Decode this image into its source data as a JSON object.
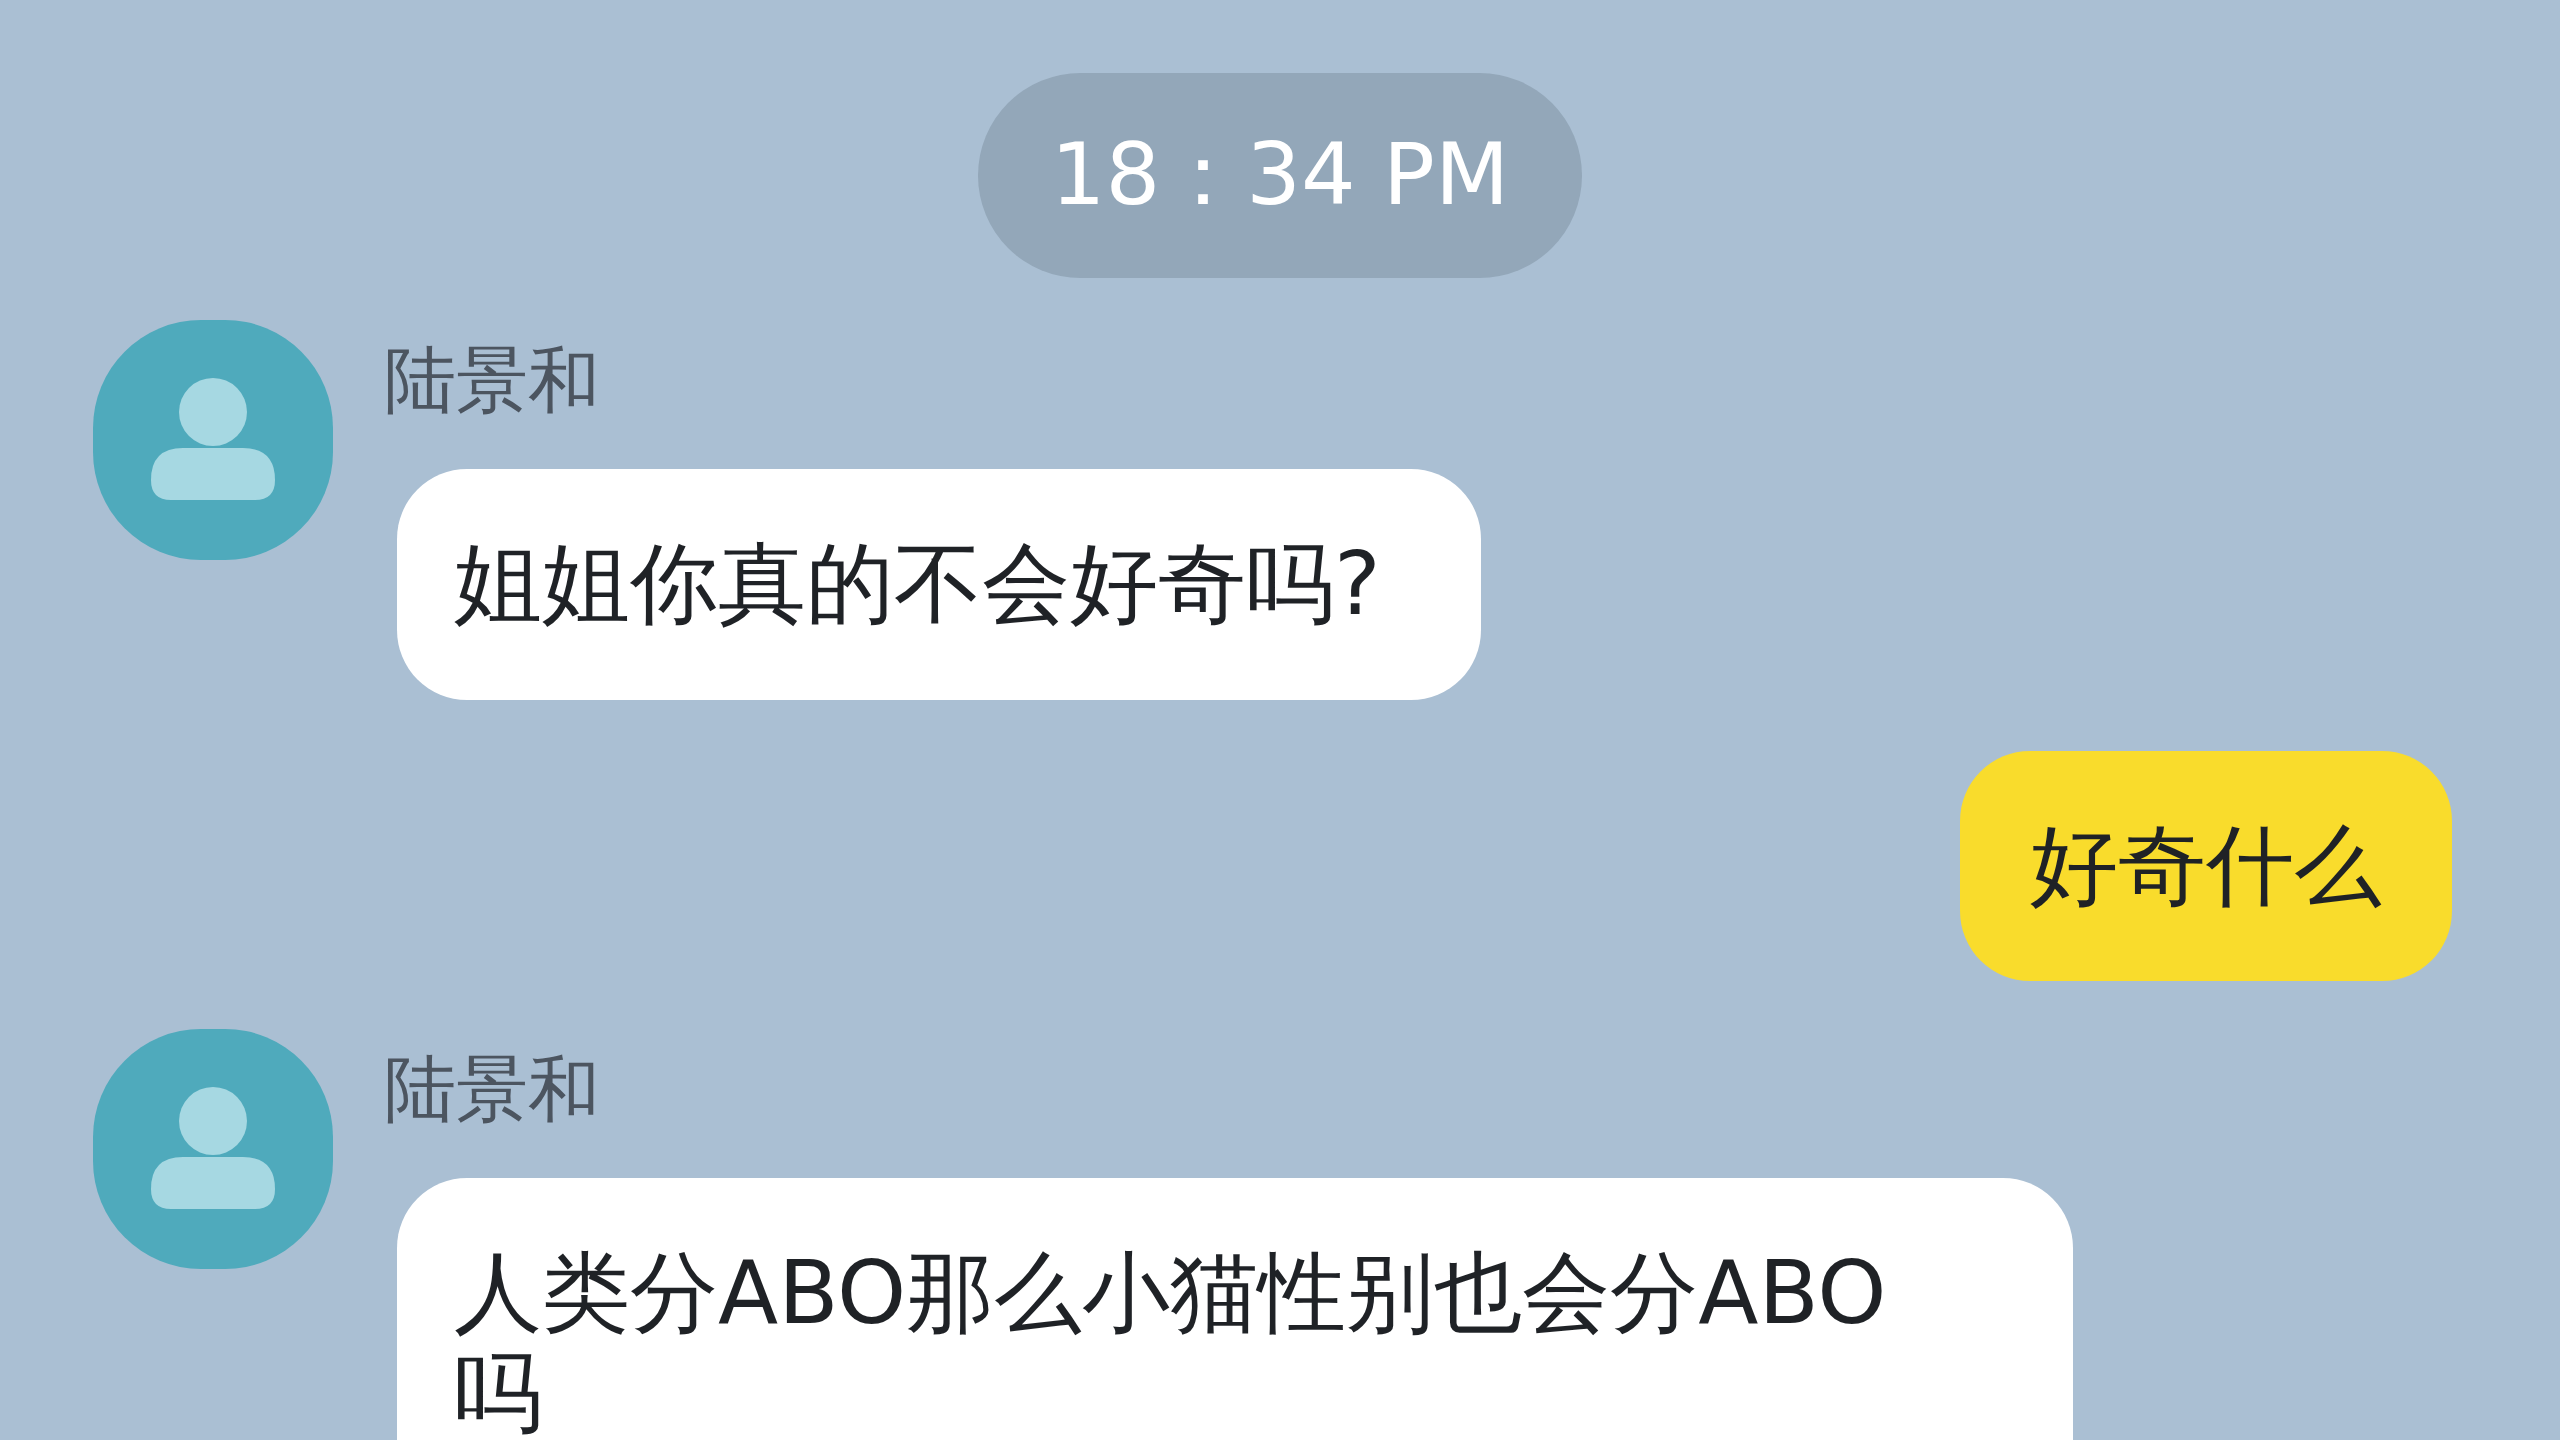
{
  "timestamp": "18：34 PM",
  "messages": [
    {
      "kind": "incoming",
      "sender": "陆景和",
      "text": "姐姐你真的不会好奇吗?"
    },
    {
      "kind": "outgoing",
      "text": "好奇什么"
    },
    {
      "kind": "incoming",
      "sender": "陆景和",
      "text": "人类分ABO那么小猫性别也会分ABO吗"
    }
  ]
}
